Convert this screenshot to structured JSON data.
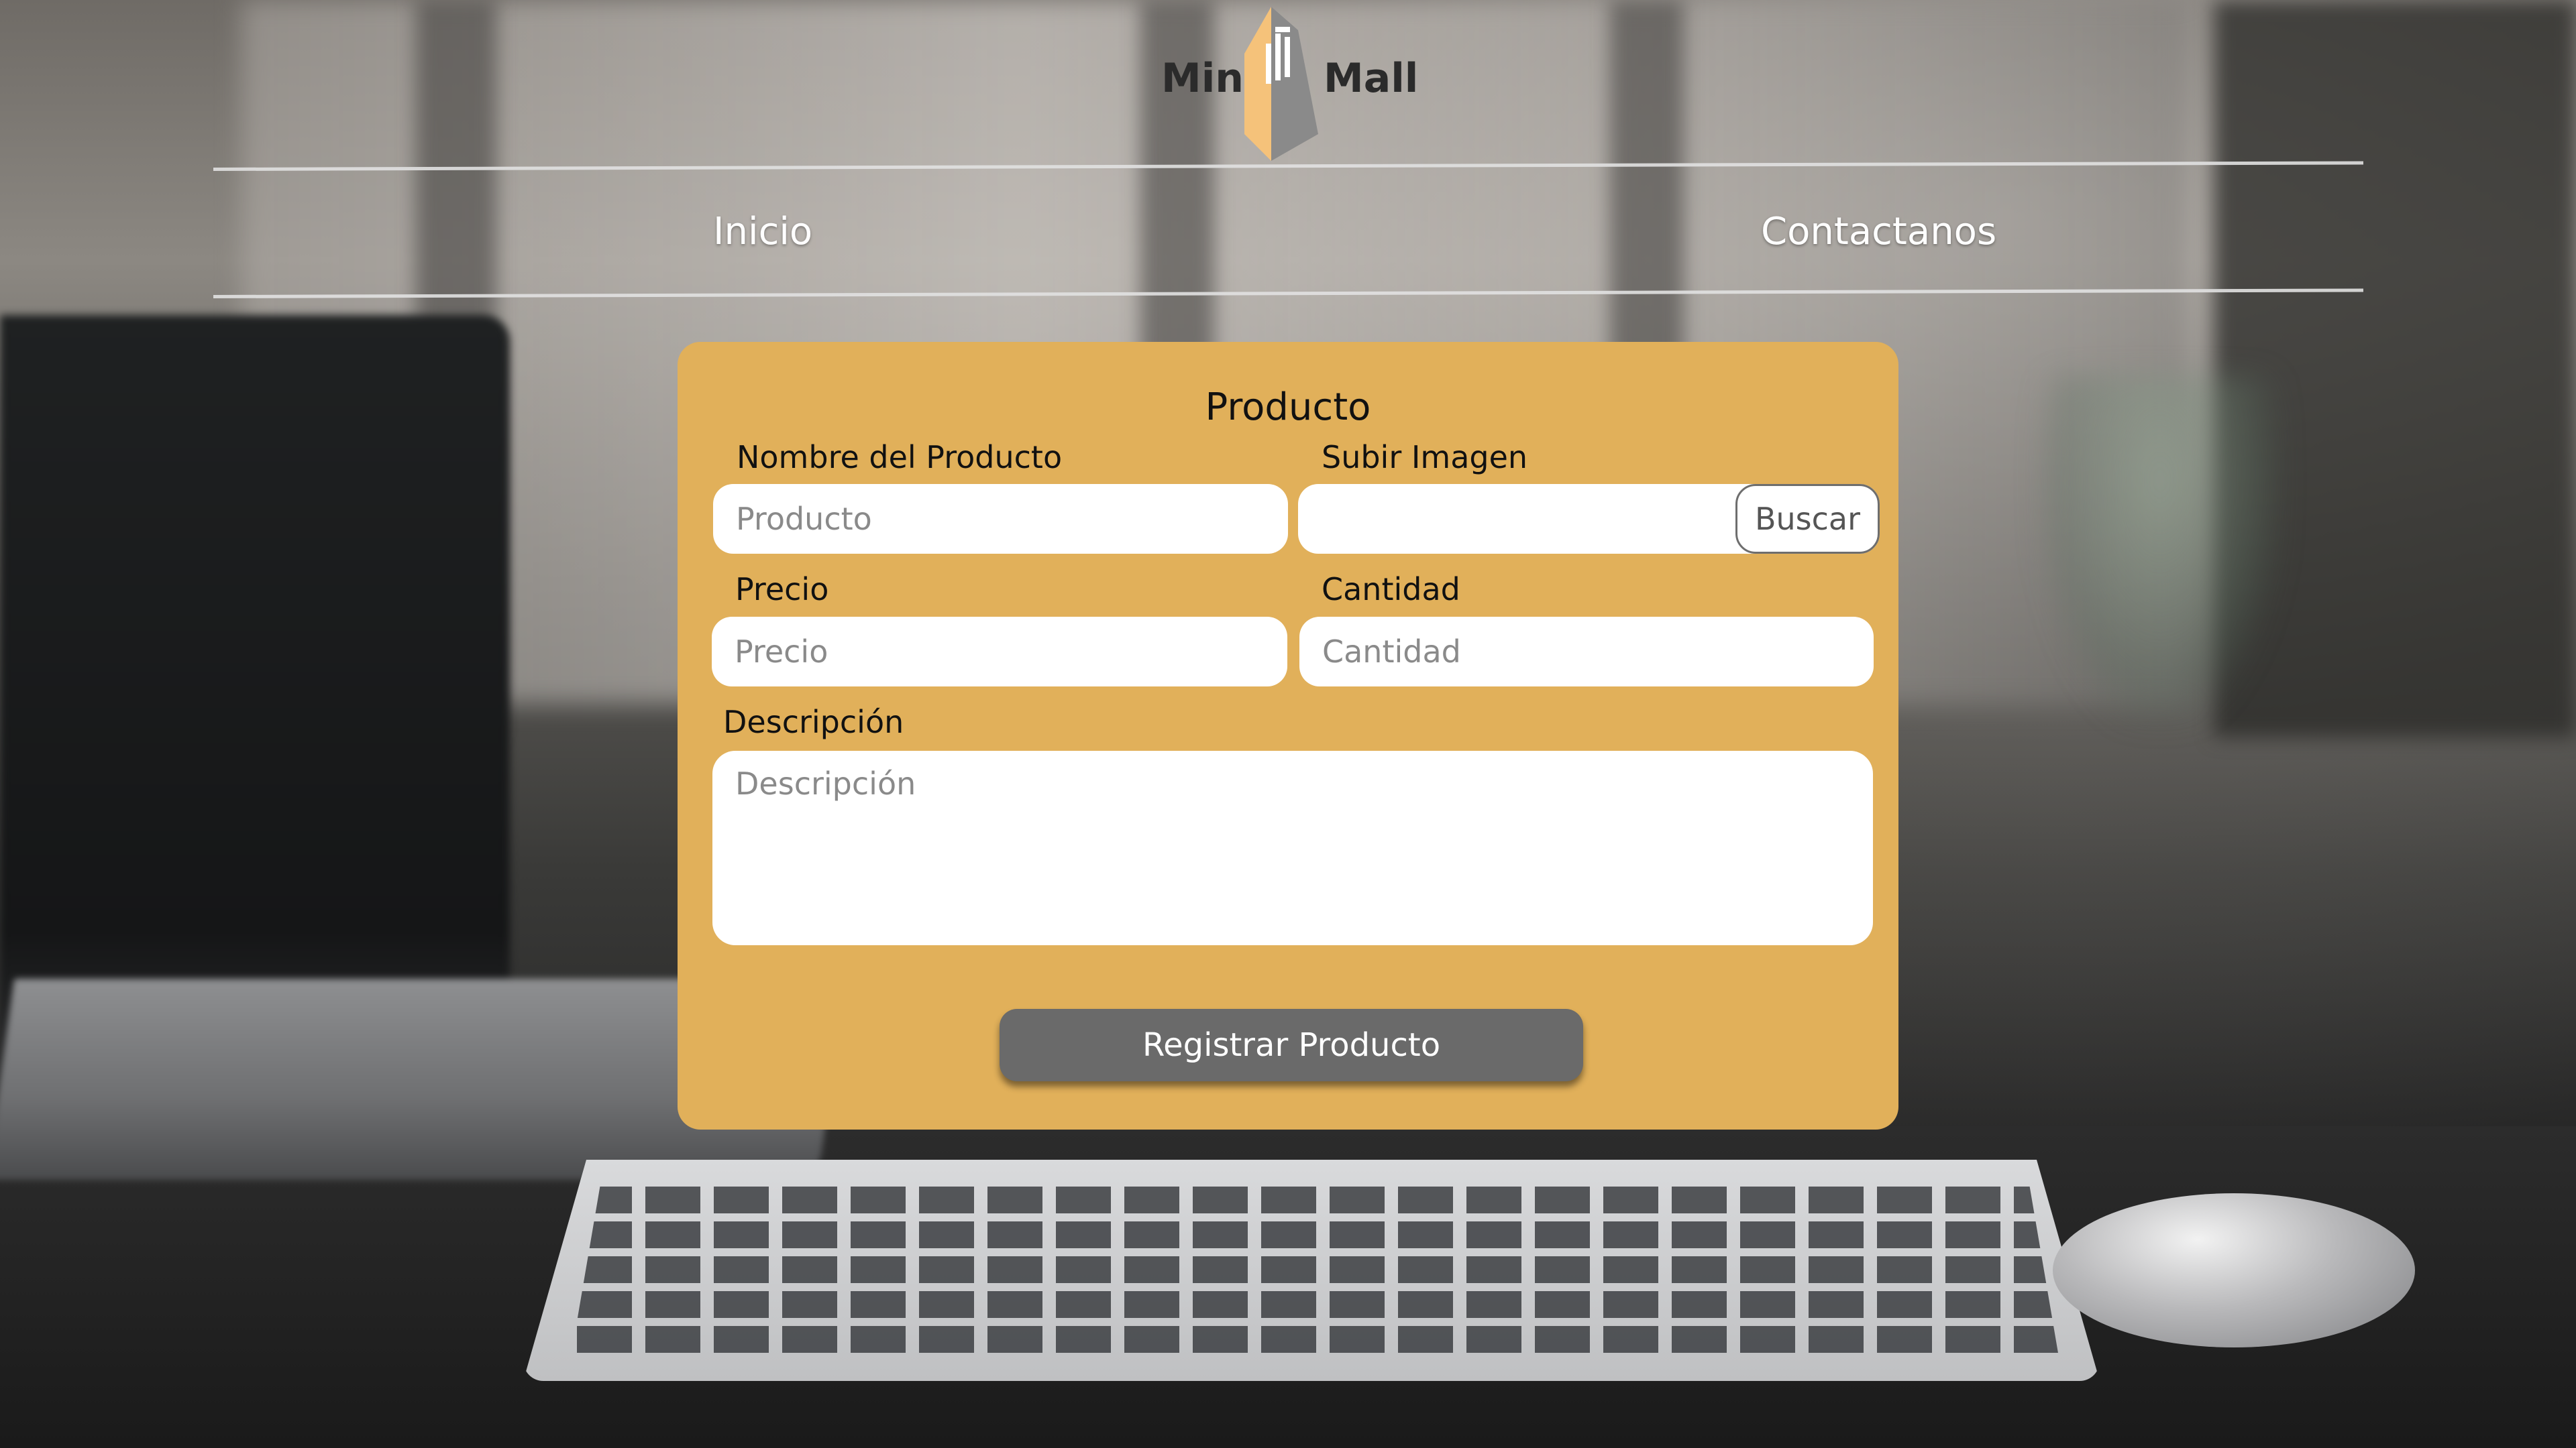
{
  "header": {
    "logo": {
      "word_left": "Mini",
      "word_right": "Mall",
      "icon": "building-logo-icon"
    },
    "nav": [
      {
        "label": "Inicio"
      },
      {
        "label": "Contactanos"
      }
    ]
  },
  "form": {
    "title": "Producto",
    "fields": {
      "nombre": {
        "label": "Nombre del Producto",
        "placeholder": "Producto",
        "value": ""
      },
      "imagen": {
        "label": "Subir Imagen",
        "button_label": "Buscar",
        "value": ""
      },
      "precio": {
        "label": "Precio",
        "placeholder": "Precio",
        "value": ""
      },
      "cantidad": {
        "label": "Cantidad",
        "placeholder": "Cantidad",
        "value": ""
      },
      "descripcion": {
        "label": "Descripción",
        "placeholder": "Descripción",
        "value": ""
      }
    },
    "submit_label": "Registrar Producto"
  },
  "colors": {
    "card_background": "#e1b05a",
    "submit_background": "#6a6a6a",
    "logo_orange": "#f5c27a",
    "logo_gray": "#8a8a8a"
  }
}
